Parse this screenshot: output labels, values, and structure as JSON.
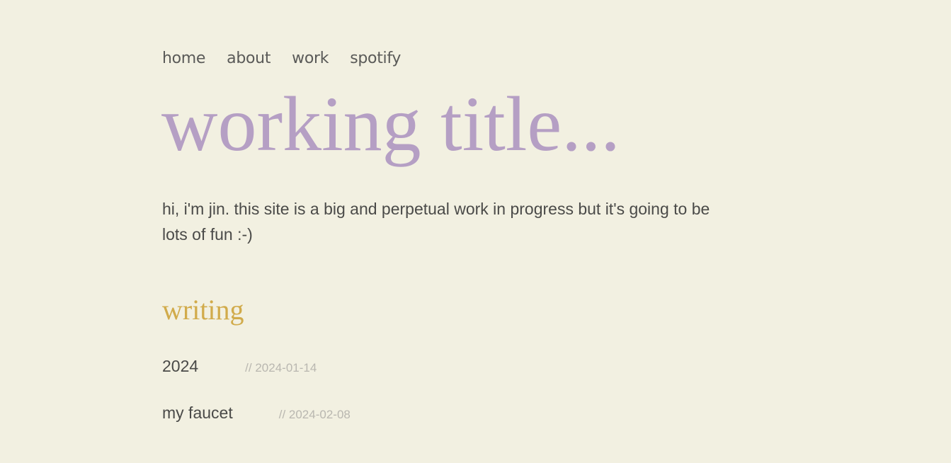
{
  "nav": {
    "items": [
      {
        "label": "home"
      },
      {
        "label": "about"
      },
      {
        "label": "work"
      },
      {
        "label": "spotify"
      }
    ]
  },
  "hero": {
    "title": "working title...",
    "intro": "hi, i'm jin. this site is a big and perpetual work in progress but it's going to be lots of fun :-)"
  },
  "writing": {
    "heading": "writing",
    "posts": [
      {
        "title": "2024",
        "date": "// 2024-01-14"
      },
      {
        "title": "my faucet",
        "date": "// 2024-02-08"
      }
    ]
  },
  "colors": {
    "background": "#f2f0e1",
    "title": "#b59fc4",
    "section_heading": "#d1ab4b",
    "text": "#4a4a48",
    "date": "#b9b7b0"
  }
}
